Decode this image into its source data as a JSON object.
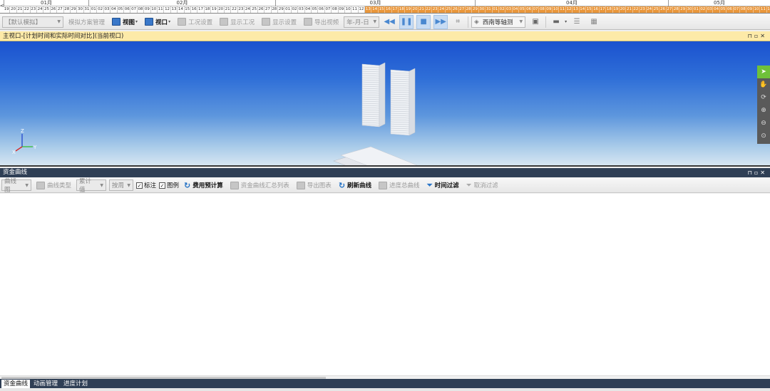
{
  "timeline": {
    "left_arrow": "<",
    "months": [
      "01月",
      "02月",
      "03月",
      "04月",
      "05月"
    ],
    "days": [
      "19",
      "20",
      "21",
      "22",
      "23",
      "24",
      "25",
      "26",
      "27",
      "28",
      "29",
      "30",
      "31",
      "01",
      "02",
      "03",
      "04",
      "05",
      "06",
      "07",
      "08",
      "09",
      "10",
      "11",
      "12",
      "13",
      "14",
      "15",
      "16",
      "17",
      "18",
      "19",
      "20",
      "21",
      "22",
      "23",
      "24",
      "25",
      "26",
      "27",
      "28",
      "29",
      "01",
      "02",
      "03",
      "04",
      "05",
      "06",
      "07",
      "08",
      "09",
      "10",
      "11",
      "12",
      "13",
      "14",
      "15",
      "16",
      "17",
      "18",
      "19",
      "20",
      "21",
      "22",
      "23",
      "24",
      "25",
      "26",
      "27",
      "28",
      "29",
      "30",
      "31",
      "01",
      "02",
      "03",
      "04",
      "05",
      "06",
      "07",
      "08",
      "09",
      "10",
      "11",
      "12",
      "13",
      "14",
      "15",
      "16",
      "17",
      "18",
      "19",
      "20",
      "21",
      "22",
      "23",
      "24",
      "25",
      "26",
      "27",
      "28",
      "29",
      "30",
      "01",
      "02",
      "03",
      "04",
      "05",
      "06",
      "07",
      "08",
      "09",
      "10",
      "11",
      "12",
      "13",
      "14"
    ]
  },
  "toolbar": {
    "scheme_combo": "【默认模拟】",
    "scheme_manage": "模拟方案管理",
    "view_label": "视图",
    "window_label": "视口",
    "work_settings": "工况设置",
    "show_work": "显示工况",
    "display_settings": "显示设置",
    "export_video": "导出视频",
    "date_format": "年-月-日",
    "view_direction": "西南等轴测"
  },
  "viewport": {
    "title": "主视口-[计划时间和实际时间对比](当前视口)",
    "axis_x": "X",
    "axis_y": "Y",
    "axis_z": "Z"
  },
  "cost_panel": {
    "title": "资金曲线",
    "curve_chart": "曲线图",
    "curve_type": "曲线类型",
    "cumulative": "累计值",
    "by_week": "按周",
    "label_check": "标注",
    "legend_check": "图例",
    "cost_estimate": "费用预计算",
    "summary_list": "资金曲线汇总列表",
    "export_chart": "导出图表",
    "refresh_curve": "刷新曲线",
    "progress_curve": "进度总曲线",
    "time_filter": "时间过滤",
    "cancel_filter": "取消过滤"
  },
  "bottom_tabs": [
    "资金曲线",
    "动画管理",
    "进度计划"
  ],
  "colors": {
    "timeline_done": "#e9963a",
    "viewport_header": "#fdeaa8",
    "panel_header": "#2f3f55",
    "active_tool": "#6fc13a"
  }
}
